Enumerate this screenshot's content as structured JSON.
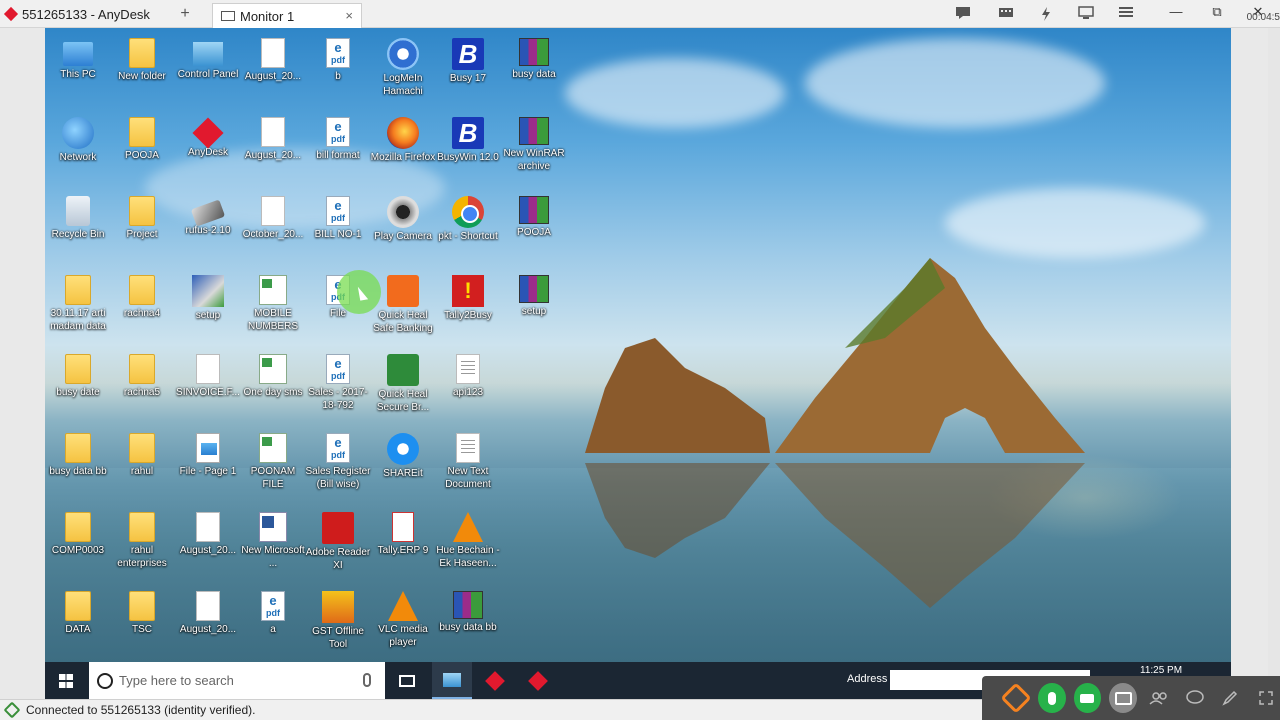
{
  "window": {
    "app_tab_label": "551265133 - AnyDesk",
    "new_tab_glyph": "+",
    "monitor_tab_label": "Monitor 1",
    "monitor_tab_close": "×",
    "session_timer": "00:04:5",
    "controls": {
      "minimize": "—",
      "restore": "⧉",
      "close": "✕"
    },
    "toolbar_icons": [
      "chat-icon",
      "keyboard-icon",
      "action-icon",
      "display-icon",
      "menu-icon"
    ]
  },
  "desktop": {
    "icons": [
      {
        "label": "This PC",
        "glyph": "pc",
        "col": 0,
        "row": 0
      },
      {
        "label": "New folder",
        "glyph": "folder",
        "col": 1,
        "row": 0
      },
      {
        "label": "Control Panel",
        "glyph": "ctrl",
        "col": 2,
        "row": 0
      },
      {
        "label": "August_20...",
        "glyph": "doc",
        "col": 3,
        "row": 0
      },
      {
        "label": "b",
        "glyph": "pdf",
        "col": 4,
        "row": 0
      },
      {
        "label": "LogMeIn Hamachi",
        "glyph": "logmein",
        "col": 5,
        "row": 0
      },
      {
        "label": "Busy 17",
        "glyph": "busy",
        "col": 6,
        "row": 0
      },
      {
        "label": "busy data",
        "glyph": "rar",
        "col": 7,
        "row": 0
      },
      {
        "label": "Network",
        "glyph": "net",
        "col": 0,
        "row": 1
      },
      {
        "label": "POOJA",
        "glyph": "folder",
        "col": 1,
        "row": 1
      },
      {
        "label": "AnyDesk",
        "glyph": "anydesk",
        "col": 2,
        "row": 1
      },
      {
        "label": "August_20...",
        "glyph": "doc",
        "col": 3,
        "row": 1
      },
      {
        "label": "bill format",
        "glyph": "pdf",
        "col": 4,
        "row": 1
      },
      {
        "label": "Mozilla Firefox",
        "glyph": "firefox",
        "col": 5,
        "row": 1
      },
      {
        "label": "BusyWin 12.0",
        "glyph": "busy",
        "col": 6,
        "row": 1
      },
      {
        "label": "New WinRAR archive",
        "glyph": "rar",
        "col": 7,
        "row": 1
      },
      {
        "label": "Recycle Bin",
        "glyph": "bin",
        "col": 0,
        "row": 2
      },
      {
        "label": "Project",
        "glyph": "folder",
        "col": 1,
        "row": 2
      },
      {
        "label": "rufus-2.10",
        "glyph": "rufus",
        "col": 2,
        "row": 2
      },
      {
        "label": "October_20...",
        "glyph": "doc",
        "col": 3,
        "row": 2
      },
      {
        "label": "BILL NO-1",
        "glyph": "pdf",
        "col": 4,
        "row": 2
      },
      {
        "label": "Play Camera",
        "glyph": "camera",
        "col": 5,
        "row": 2
      },
      {
        "label": "pkt - Shortcut",
        "glyph": "chrome",
        "col": 6,
        "row": 2
      },
      {
        "label": "POOJA",
        "glyph": "rar",
        "col": 7,
        "row": 2
      },
      {
        "label": "30.11.17 arti madam data",
        "glyph": "folder",
        "col": 0,
        "row": 3
      },
      {
        "label": "rachna4",
        "glyph": "folder",
        "col": 1,
        "row": 3
      },
      {
        "label": "setup",
        "glyph": "setup",
        "col": 2,
        "row": 3
      },
      {
        "label": "MOBILE NUMBERS",
        "glyph": "xl",
        "col": 3,
        "row": 3
      },
      {
        "label": "File",
        "glyph": "pdf",
        "col": 4,
        "row": 3
      },
      {
        "label": "Quick Heal Safe Banking",
        "glyph": "qh",
        "col": 5,
        "row": 3
      },
      {
        "label": "Tally2Busy",
        "glyph": "tally2busy",
        "col": 6,
        "row": 3
      },
      {
        "label": "setup",
        "glyph": "rar",
        "col": 7,
        "row": 3
      },
      {
        "label": "busy date",
        "glyph": "folder",
        "col": 0,
        "row": 4
      },
      {
        "label": "rachna5",
        "glyph": "folder",
        "col": 1,
        "row": 4
      },
      {
        "label": "SINVOICE.F...",
        "glyph": "doc",
        "col": 2,
        "row": 4
      },
      {
        "label": "One day sms",
        "glyph": "xl",
        "col": 3,
        "row": 4
      },
      {
        "label": "Sales - 2017-18-792",
        "glyph": "pdf",
        "col": 4,
        "row": 4
      },
      {
        "label": "Quick Heal Secure Br...",
        "glyph": "qh2",
        "col": 5,
        "row": 4
      },
      {
        "label": "api123",
        "glyph": "txt",
        "col": 6,
        "row": 4
      },
      {
        "label": "busy data bb",
        "glyph": "folder",
        "col": 0,
        "row": 5
      },
      {
        "label": "rahul",
        "glyph": "folder",
        "col": 1,
        "row": 5
      },
      {
        "label": "File - Page 1",
        "glyph": "img",
        "col": 2,
        "row": 5
      },
      {
        "label": "POONAM FILE",
        "glyph": "xl",
        "col": 3,
        "row": 5
      },
      {
        "label": "Sales Register (Bill wise)",
        "glyph": "pdf",
        "col": 4,
        "row": 5
      },
      {
        "label": "SHAREit",
        "glyph": "shareit",
        "col": 5,
        "row": 5
      },
      {
        "label": "New Text Document",
        "glyph": "txt",
        "col": 6,
        "row": 5
      },
      {
        "label": "COMP0003",
        "glyph": "folder",
        "col": 0,
        "row": 6
      },
      {
        "label": "rahul enterprises",
        "glyph": "folder",
        "col": 1,
        "row": 6
      },
      {
        "label": "August_20...",
        "glyph": "doc",
        "col": 2,
        "row": 6
      },
      {
        "label": "New Microsoft ...",
        "glyph": "word",
        "col": 3,
        "row": 6
      },
      {
        "label": "Adobe Reader XI",
        "glyph": "acrobat",
        "col": 4,
        "row": 6
      },
      {
        "label": "Tally.ERP 9",
        "glyph": "tally",
        "col": 5,
        "row": 6
      },
      {
        "label": "Hue Bechain - Ek Haseen...",
        "glyph": "vlc",
        "col": 6,
        "row": 6
      },
      {
        "label": "DATA",
        "glyph": "folder",
        "col": 0,
        "row": 7
      },
      {
        "label": "TSC",
        "glyph": "folder",
        "col": 1,
        "row": 7
      },
      {
        "label": "August_20...",
        "glyph": "doc",
        "col": 2,
        "row": 7
      },
      {
        "label": "a",
        "glyph": "pdf",
        "col": 3,
        "row": 7
      },
      {
        "label": "GST Offline Tool",
        "glyph": "gst",
        "col": 4,
        "row": 7
      },
      {
        "label": "VLC media player",
        "glyph": "vlc",
        "col": 5,
        "row": 7
      },
      {
        "label": "busy data bb",
        "glyph": "rar",
        "col": 6,
        "row": 7
      }
    ]
  },
  "taskbar": {
    "search_placeholder": "Type here to search",
    "address_label": "Address",
    "clock": "11:25 PM"
  },
  "status": {
    "text": "Connected to 551265133 (identity verified)."
  },
  "session_toolbar": {
    "buttons": [
      "anydesk-icon",
      "microphone-icon",
      "chat-bubble-icon",
      "video-icon",
      "users-icon",
      "comment-icon",
      "pen-icon",
      "fullscreen-icon"
    ]
  }
}
